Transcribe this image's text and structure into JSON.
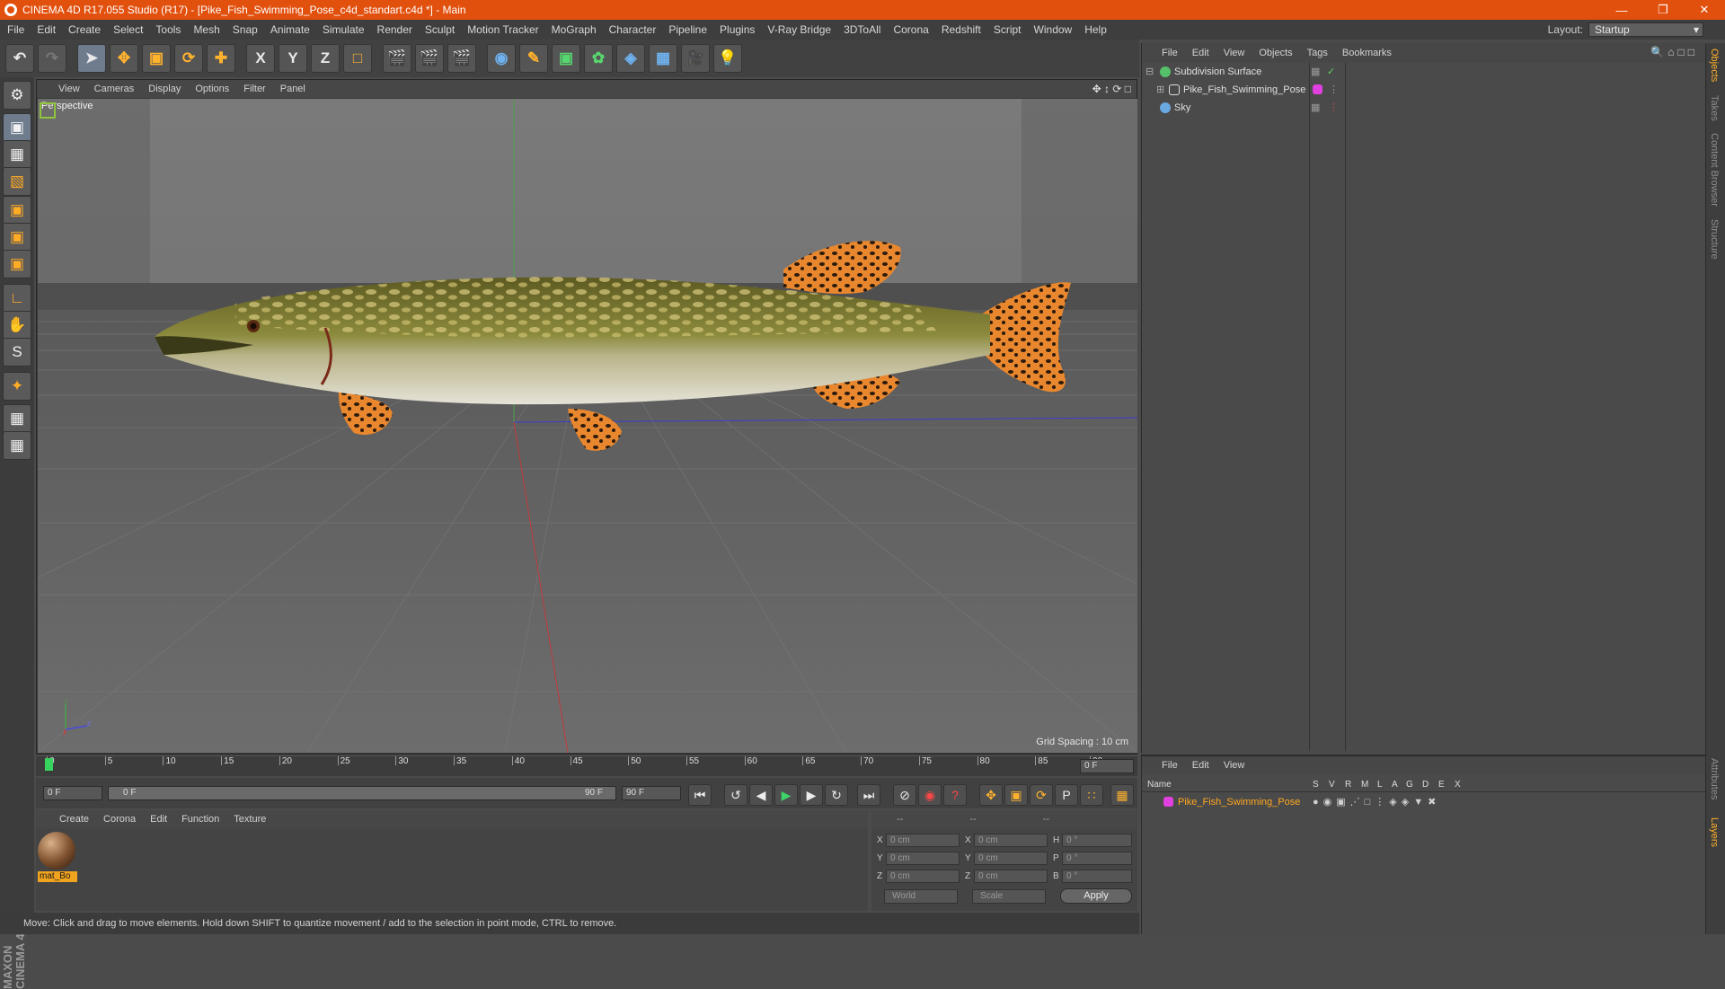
{
  "window": {
    "title": "CINEMA 4D R17.055 Studio (R17) - [Pike_Fish_Swimming_Pose_c4d_standart.c4d *] - Main"
  },
  "menu": [
    "File",
    "Edit",
    "Create",
    "Select",
    "Tools",
    "Mesh",
    "Snap",
    "Animate",
    "Simulate",
    "Render",
    "Sculpt",
    "Motion Tracker",
    "MoGraph",
    "Character",
    "Pipeline",
    "Plugins",
    "V-Ray Bridge",
    "3DToAll",
    "Corona",
    "Redshift",
    "Script",
    "Window",
    "Help"
  ],
  "layout": {
    "label": "Layout:",
    "value": "Startup"
  },
  "viewport": {
    "menu": [
      "View",
      "Cameras",
      "Display",
      "Options",
      "Filter",
      "Panel"
    ],
    "label": "Perspective",
    "grid_spacing": "Grid Spacing : 10 cm"
  },
  "timeline": {
    "ticks": [
      "0",
      "5",
      "10",
      "15",
      "20",
      "25",
      "30",
      "35",
      "40",
      "45",
      "50",
      "55",
      "60",
      "65",
      "70",
      "75",
      "80",
      "85",
      "90"
    ],
    "current_field": "0 F",
    "start": "0 F",
    "range_start": "0 F",
    "range_end": "90 F",
    "end": "90 F",
    "frame_right": "0 F"
  },
  "materials": {
    "menu": [
      "Create",
      "Corona",
      "Edit",
      "Function",
      "Texture"
    ],
    "items": [
      {
        "name": "mat_Bo"
      }
    ]
  },
  "coords": {
    "headers": [
      "--",
      "--",
      "--"
    ],
    "rows": [
      {
        "a": "X",
        "av": "0 cm",
        "b": "X",
        "bv": "0 cm",
        "c": "H",
        "cv": "0 °"
      },
      {
        "a": "Y",
        "av": "0 cm",
        "b": "Y",
        "bv": "0 cm",
        "c": "P",
        "cv": "0 °"
      },
      {
        "a": "Z",
        "av": "0 cm",
        "b": "Z",
        "bv": "0 cm",
        "c": "B",
        "cv": "0 °"
      }
    ],
    "mode": "World",
    "scale": "Scale",
    "apply": "Apply"
  },
  "status": "Move: Click and drag to move elements. Hold down SHIFT to quantize movement / add to the selection in point mode, CTRL to remove.",
  "objects": {
    "menu": [
      "File",
      "Edit",
      "View",
      "Objects",
      "Tags",
      "Bookmarks"
    ],
    "items": [
      {
        "name": "Subdivision Surface"
      },
      {
        "name": "Pike_Fish_Swimming_Pose"
      },
      {
        "name": "Sky"
      }
    ]
  },
  "layers": {
    "menu": [
      "File",
      "Edit",
      "View"
    ],
    "columns": [
      "Name",
      "S",
      "V",
      "R",
      "M",
      "L",
      "A",
      "G",
      "D",
      "E",
      "X"
    ],
    "items": [
      {
        "name": "Pike_Fish_Swimming_Pose"
      }
    ]
  },
  "side_tabs": [
    "Objects",
    "Takes",
    "Content Browser",
    "Structure"
  ],
  "side_tabs_bottom": [
    "Attributes",
    "Layers"
  ],
  "brand": "MAXON CINEMA 4D",
  "colors": {
    "title_bar": "#e2500e",
    "accent": "#ffa820",
    "layer_color": "#e040e0"
  }
}
